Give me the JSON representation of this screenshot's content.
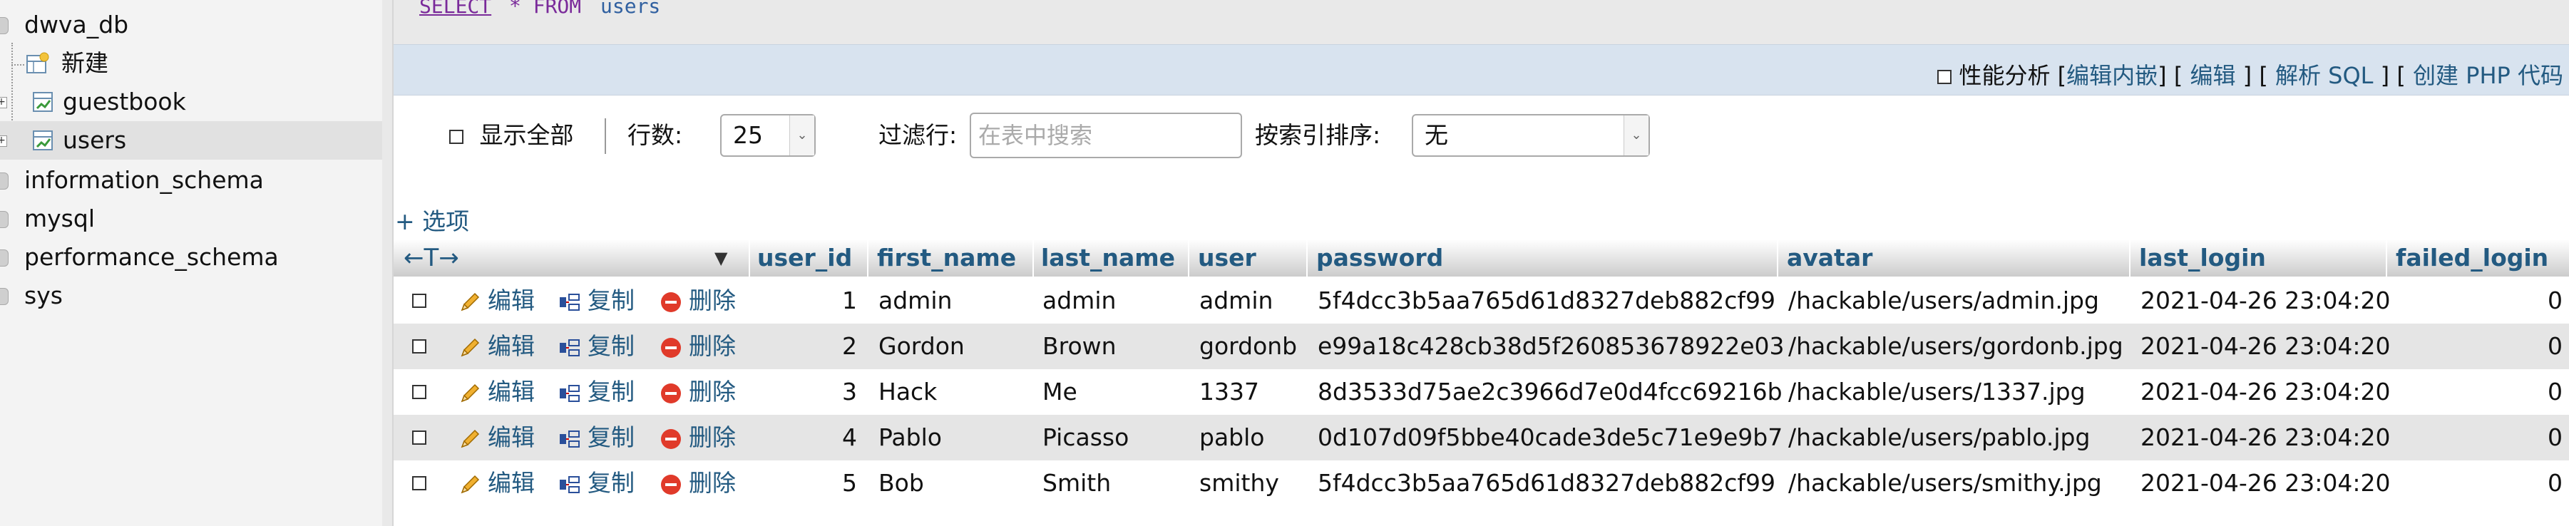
{
  "sidebar": {
    "top_db": {
      "label": "dwva_db"
    },
    "tree": [
      {
        "label": "新建",
        "type": "new"
      },
      {
        "label": "guestbook",
        "type": "table"
      },
      {
        "label": "users",
        "type": "table",
        "selected": true
      }
    ],
    "other_dbs": [
      {
        "label": "information_schema"
      },
      {
        "label": "mysql"
      },
      {
        "label": "performance_schema"
      },
      {
        "label": "sys"
      }
    ]
  },
  "sql": {
    "select": "SELECT",
    "star_from": "* FROM",
    "table": "users"
  },
  "sql_bar": {
    "profiling_label": "性能分析",
    "links": [
      "编辑内嵌",
      "编辑",
      "解析 SQL",
      "创建 PHP 代码"
    ]
  },
  "controls": {
    "show_all": "显示全部",
    "rows_label": "行数:",
    "rows_value": "25",
    "filter_label": "过滤行:",
    "filter_placeholder": "在表中搜索",
    "sort_label": "按索引排序:",
    "sort_value": "无"
  },
  "options_link": "+ 选项",
  "table": {
    "arrows": "←T→",
    "columns": [
      "user_id",
      "first_name",
      "last_name",
      "user",
      "password",
      "avatar",
      "last_login",
      "failed_login"
    ],
    "actions": {
      "edit": "编辑",
      "copy": "复制",
      "delete": "删除"
    },
    "rows": [
      {
        "user_id": "1",
        "first_name": "admin",
        "last_name": "admin",
        "user": "admin",
        "password": "5f4dcc3b5aa765d61d8327deb882cf99",
        "avatar": "/hackable/users/admin.jpg",
        "last_login": "2021-04-26 23:04:20",
        "failed_login": "0"
      },
      {
        "user_id": "2",
        "first_name": "Gordon",
        "last_name": "Brown",
        "user": "gordonb",
        "password": "e99a18c428cb38d5f260853678922e03",
        "avatar": "/hackable/users/gordonb.jpg",
        "last_login": "2021-04-26 23:04:20",
        "failed_login": "0"
      },
      {
        "user_id": "3",
        "first_name": "Hack",
        "last_name": "Me",
        "user": "1337",
        "password": "8d3533d75ae2c3966d7e0d4fcc69216b",
        "avatar": "/hackable/users/1337.jpg",
        "last_login": "2021-04-26 23:04:20",
        "failed_login": "0"
      },
      {
        "user_id": "4",
        "first_name": "Pablo",
        "last_name": "Picasso",
        "user": "pablo",
        "password": "0d107d09f5bbe40cade3de5c71e9e9b7",
        "avatar": "/hackable/users/pablo.jpg",
        "last_login": "2021-04-26 23:04:20",
        "failed_login": "0"
      },
      {
        "user_id": "5",
        "first_name": "Bob",
        "last_name": "Smith",
        "user": "smithy",
        "password": "5f4dcc3b5aa765d61d8327deb882cf99",
        "avatar": "/hackable/users/smithy.jpg",
        "last_login": "2021-04-26 23:04:20",
        "failed_login": "0"
      }
    ]
  },
  "colors": {
    "link": "#235a81",
    "row_even": "#e5e5e5",
    "sql_bar": "#d8e3ef"
  }
}
